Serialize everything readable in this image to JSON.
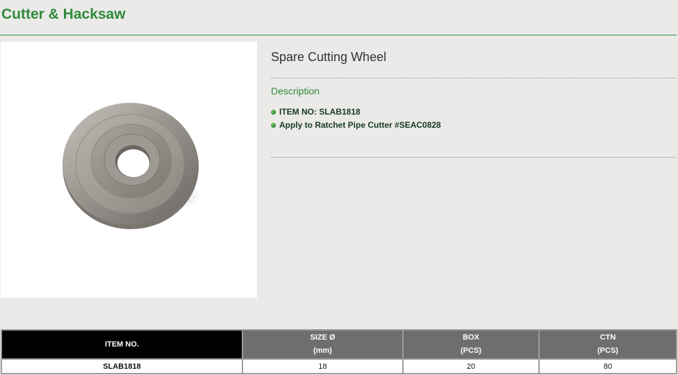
{
  "header": {
    "title": "Cutter & Hacksaw"
  },
  "product": {
    "name": "Spare Cutting Wheel",
    "image_icon": "cutting-wheel-image",
    "description_heading": "Description",
    "description_items": [
      "ITEM NO: SLAB1818",
      "Apply to Ratchet Pipe Cutter #SEAC0828"
    ]
  },
  "spec_table": {
    "headers": [
      {
        "line1": "ITEM NO.",
        "line2": ""
      },
      {
        "line1": "SIZE Ø",
        "line2": "(mm)"
      },
      {
        "line1": "BOX",
        "line2": "(PCS)"
      },
      {
        "line1": "CTN",
        "line2": "(PCS)"
      }
    ],
    "rows": [
      [
        "SLAB1818",
        "18",
        "20",
        "80"
      ]
    ]
  },
  "colors": {
    "accent": "#2f8a3c",
    "background": "#ebeae8",
    "header_dark": "#000000",
    "header_gray": "#6e6e6e"
  }
}
